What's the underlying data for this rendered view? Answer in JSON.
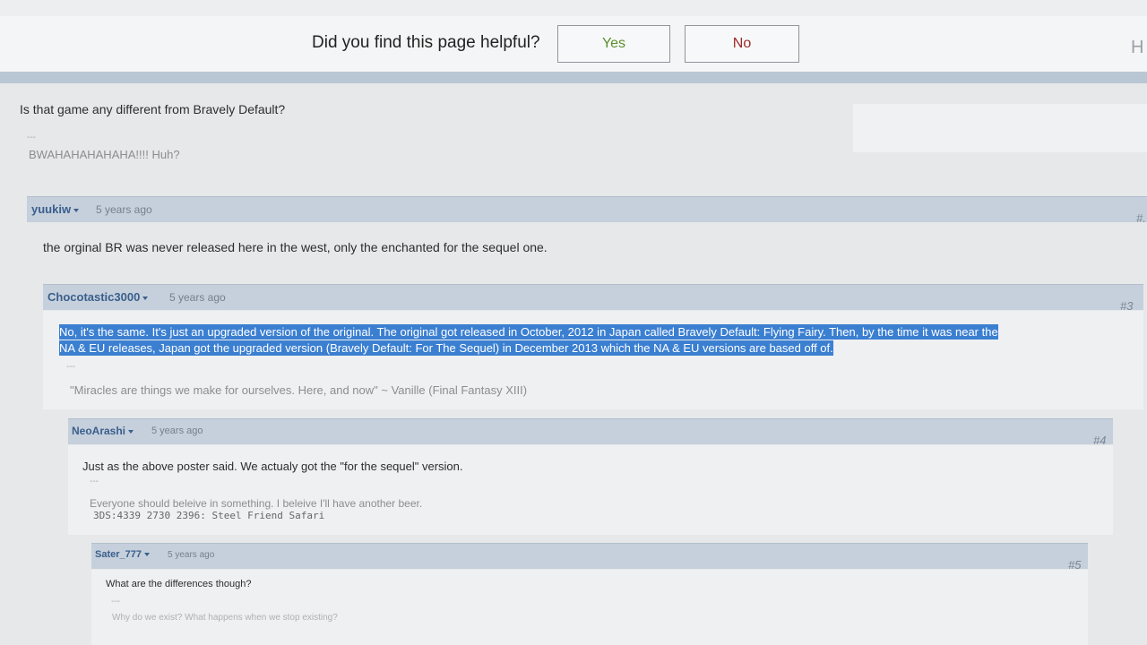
{
  "feedback": {
    "question": "Did you find this page helpful?",
    "yes_label": "Yes",
    "no_label": "No",
    "edge_letter": "H"
  },
  "first_post": {
    "text": "Is that game any different from Bravely Default?",
    "sig_sep": "---",
    "signature": "BWAHAHAHAHAHA!!!! Huh?"
  },
  "posts": [
    {
      "user": "yuukiw",
      "ago": "5 years ago",
      "num": "#.",
      "text": "the orginal BR was never released here in the west, only the enchanted for the sequel one."
    },
    {
      "user": "Chocotastic3000",
      "ago": "5 years ago",
      "num": "#3",
      "text_line1": "No, it's the same. It's just an upgraded version of the original. The original got released in October, 2012 in Japan called Bravely Default: Flying Fairy. Then, by the time it was near the",
      "text_line2": "NA & EU releases, Japan got the upgraded version (Bravely Default: For The Sequel) in December 2013 which the NA & EU versions are based off of.",
      "sig_sep": "---",
      "signature": "\"Miracles are things we make for ourselves. Here, and now\" ~ Vanille (Final Fantasy XIII)"
    },
    {
      "user": "NeoArashi",
      "ago": "5 years ago",
      "num": "#4",
      "text": "Just as the above poster said. We actualy got the \"for the sequel\" version.",
      "sig_sep": "---",
      "signature": "Everyone should beleive in something. I beleive I'll have another beer.",
      "signature2": "3DS:4339 2730 2396: Steel Friend Safari"
    },
    {
      "user": "Sater_777",
      "ago": "5 years ago",
      "num": "#5",
      "text": "What are the differences though?",
      "sig_sep": "---",
      "signature": "Why do we exist? What happens when we stop existing?"
    }
  ]
}
